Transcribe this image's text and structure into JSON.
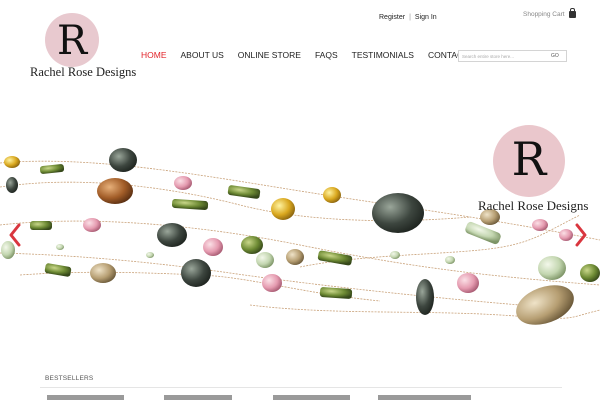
{
  "header": {
    "logo_letter": "R",
    "logo_name": "Rachel Rose Designs",
    "register_label": "Register",
    "separator": "|",
    "signin_label": "Sign In",
    "cart_label": "Shopping Cart",
    "search_placeholder": "Search entire store here...",
    "search_go": "GO"
  },
  "nav": {
    "home": "HOME",
    "about": "ABOUT US",
    "store": "ONLINE STORE",
    "faqs": "FAQS",
    "testimonials": "TESTIMONIALS",
    "contact": "CONTACT US",
    "active_color": "#e2242a"
  },
  "hero": {
    "logo_letter": "R",
    "logo_name": "Rachel Rose Designs",
    "prev_icon": "chevron-left-icon",
    "next_icon": "chevron-right-icon",
    "arrow_color": "#d9363e"
  },
  "bestsellers": {
    "title": "BESTSELLERS"
  },
  "colors": {
    "logo_pink": "#e8c9cf",
    "accent_red": "#e2242a"
  }
}
